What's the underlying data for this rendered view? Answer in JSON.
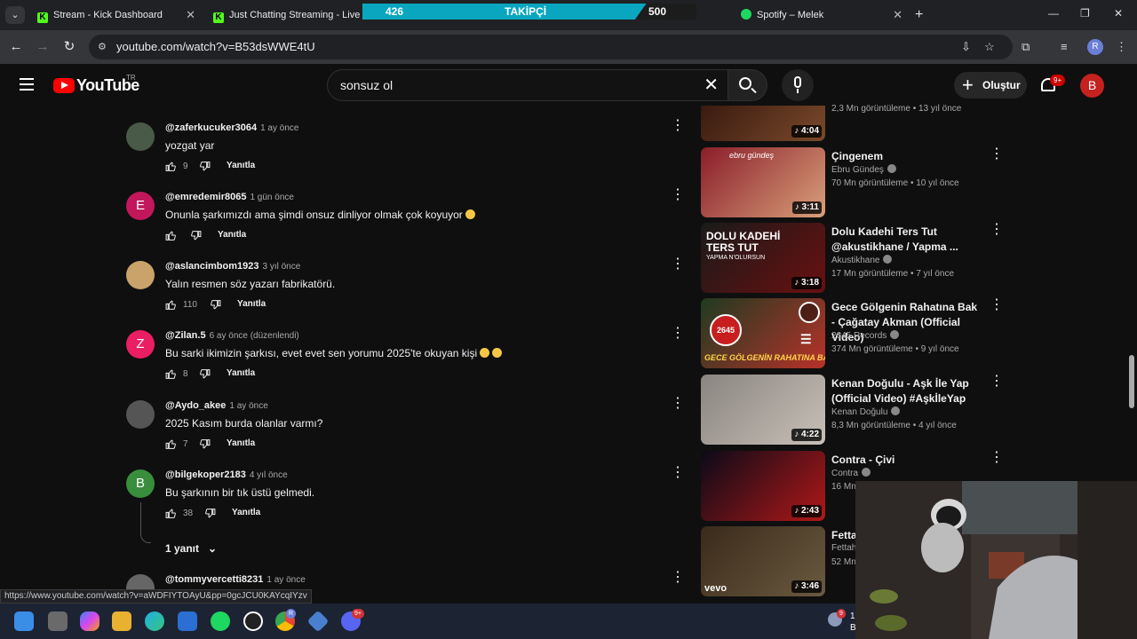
{
  "browser": {
    "tabs": [
      {
        "label": "Stream - Kick Dashboard"
      },
      {
        "label": "Just Chatting Streaming - Live S"
      },
      {
        "label": "Spotify – Melek"
      }
    ],
    "kick_letter": "K",
    "url": "youtube.com/watch?v=B53dsWWE4tU",
    "profile_letter": "R"
  },
  "follow_goal": {
    "current": "426",
    "label": "TAKİPÇİ",
    "target": "500",
    "progress_fraction": 0.85
  },
  "header": {
    "logo": "YouTube",
    "region": "TR",
    "search_value": "sonsuz ol",
    "create_label": "Oluştur",
    "notif_badge": "9+",
    "avatar_letter": "B"
  },
  "comments": [
    {
      "author": "@zaferkucuker3064",
      "time": "1 ay önce",
      "text": "yozgat yar",
      "likes": "9",
      "reply": "Yanıtla",
      "avatar": "",
      "avatar_color": "#4a5a48"
    },
    {
      "author": "@emredemir8065",
      "time": "1 gün önce",
      "text": "Onunla şarkımızdı ama şimdi onsuz dinliyor olmak çok koyuyor",
      "likes": "",
      "reply": "Yanıtla",
      "avatar": "E",
      "avatar_color": "#c2185b"
    },
    {
      "author": "@aslancimbom1923",
      "time": "3 yıl önce",
      "text": "Yalın resmen söz yazarı fabrikatörü.",
      "likes": "110",
      "reply": "Yanıtla",
      "avatar": "",
      "avatar_color": "#c9a36a"
    },
    {
      "author": "@Zilan.5",
      "time": "6 ay önce (düzenlendi)",
      "text": "Bu sarki ikimizin şarkısı, evet evet sen yorumu 2025'te okuyan kişi",
      "likes": "8",
      "reply": "Yanıtla",
      "avatar": "Z",
      "avatar_color": "#e91e63"
    },
    {
      "author": "@Aydo_akee",
      "time": "1 ay önce",
      "text": "2025 Kasım burda olanlar varmı?",
      "likes": "7",
      "reply": "Yanıtla",
      "avatar": "",
      "avatar_color": "#555555"
    },
    {
      "author": "@bilgekoper2183",
      "time": "4 yıl önce",
      "text": "Bu şarkının bir tık üstü gelmedi.",
      "likes": "38",
      "reply": "Yanıtla",
      "avatar": "B",
      "avatar_color": "#388e3c"
    },
    {
      "author": "@tommyvercetti8231",
      "time": "1 ay önce",
      "text": "",
      "likes": "",
      "reply": "",
      "avatar": "",
      "avatar_color": "#666666"
    }
  ],
  "replies_toggle": "1 yanıt",
  "sidebar": [
    {
      "title": "",
      "channel": "",
      "stats": "2,3 Mn görüntüleme • 13 yıl önce",
      "duration": "4:04",
      "color_a": "#3a1a10",
      "color_b": "#7a4a2a"
    },
    {
      "title": "Çingenem",
      "channel": "Ebru Gündeş",
      "stats": "70 Mn görüntüleme • 10 yıl önce",
      "duration": "3:11",
      "color_a": "#8a1d2a",
      "color_b": "#d9a07a",
      "thumb_text": "ebru gündeş"
    },
    {
      "title": "Dolu Kadehi Ters Tut @akustikhane / Yapma ...",
      "channel": "Akustikhane",
      "stats": "17 Mn görüntüleme • 7 yıl önce",
      "duration": "3:18",
      "color_a": "#1a1a1a",
      "color_b": "#6a1010",
      "thumb_text": "DOLU KADEHİ",
      "thumb_text2": "TERS TUT",
      "thumb_text3": "YAPMA N'OLURSUN"
    },
    {
      "title": "Gece Gölgenin Rahatına Bak - Çağatay Akman (Official  Video)",
      "channel": "2645 Records",
      "stats": "374 Mn görüntüleme • 9 yıl önce",
      "duration": "",
      "color_a": "#1f3a20",
      "color_b": "#b8322a",
      "thumb_text": "GECE GÖLGENİN RAHATINA BAK",
      "badge": "2645"
    },
    {
      "title": "Kenan Doğulu - Aşk İle Yap (Official Video) #AşkİleYap",
      "channel": "Kenan Doğulu",
      "stats": "8,3 Mn görüntüleme • 4 yıl önce",
      "duration": "4:22",
      "color_a": "#8a8580",
      "color_b": "#c8c0b8"
    },
    {
      "title": "Contra - Çivi",
      "channel": "Contra",
      "stats": "16 Mn",
      "duration": "2:43",
      "color_a": "#0a0a18",
      "color_b": "#b01818"
    },
    {
      "title": "Fetta",
      "channel": "Fettah",
      "stats": "52 Mn",
      "duration": "3:46",
      "color_a": "#3a2a1a",
      "color_b": "#6a5a40",
      "thumb_text": "vevo"
    }
  ],
  "status_url": "https://www.youtube.com/watch?v=aWDFIYTOAyU&pp=0gcJCU0KAYcqIYzv",
  "taskbar": {
    "discord_badge": "9+",
    "chrome_badge": "R",
    "notif_count": "9",
    "tray_text_1": "1",
    "tray_text_2": "B"
  },
  "colors": {
    "accent_red": "#ff0000",
    "kick_green": "#53fc18",
    "goal_cyan": "#0aa6bf"
  }
}
